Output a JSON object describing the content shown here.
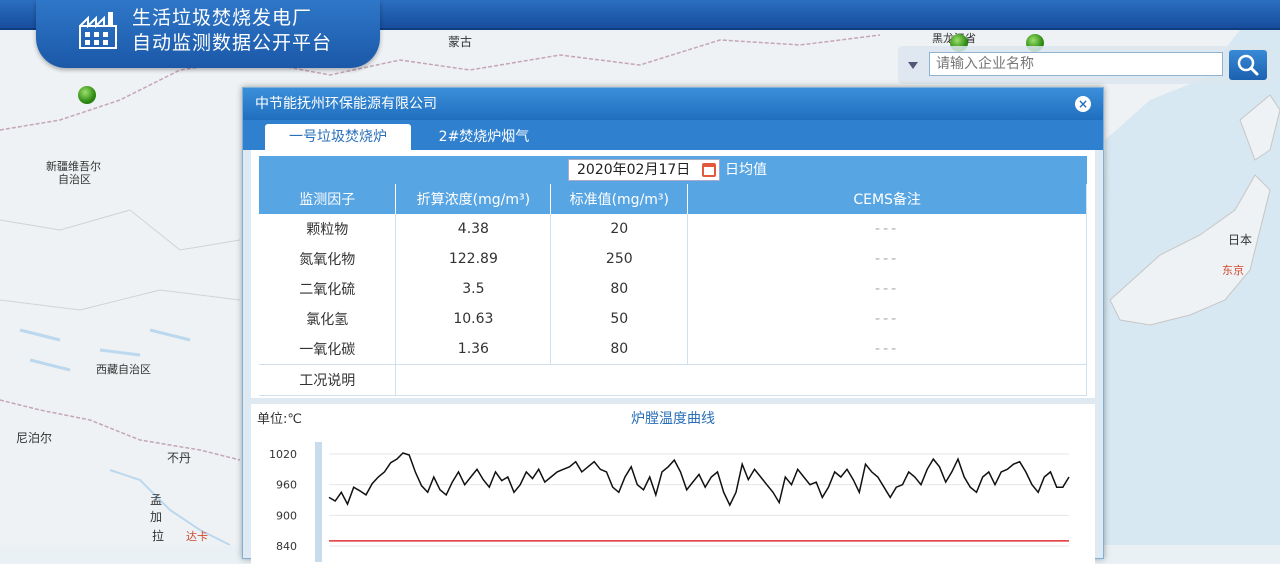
{
  "header": {
    "title_line1": "生活垃圾焚烧发电厂",
    "title_line2": "自动监测数据公开平台"
  },
  "search": {
    "placeholder": "请输入企业名称"
  },
  "map": {
    "labels": [
      {
        "key": "mongolia",
        "text": "蒙古"
      },
      {
        "key": "heilongjiang",
        "text": "黑龙江省"
      },
      {
        "key": "xinjiang1",
        "text": "新疆维吾尔"
      },
      {
        "key": "xinjiang2",
        "text": "自治区"
      },
      {
        "key": "tibet",
        "text": "西藏自治区"
      },
      {
        "key": "nepal",
        "text": "尼泊尔"
      },
      {
        "key": "bhutan",
        "text": "不丹"
      },
      {
        "key": "bangla1",
        "text": "孟"
      },
      {
        "key": "bangla2",
        "text": "加"
      },
      {
        "key": "bangla3",
        "text": "拉"
      },
      {
        "key": "dhaka",
        "text": "达卡"
      },
      {
        "key": "japan",
        "text": "日本"
      },
      {
        "key": "tokyo",
        "text": "东京"
      }
    ]
  },
  "popup": {
    "company": "中节能抚州环保能源有限公司",
    "close_symbol": "×",
    "tabs": [
      "一号垃圾焚烧炉",
      "2#焚烧炉烟气"
    ],
    "date": "2020年02月17日",
    "date_suffix": "日均值",
    "columns": [
      "监测因子",
      "折算浓度(mg/m³)",
      "标准值(mg/m³)",
      "CEMS备注"
    ],
    "rows": [
      {
        "factor": "颗粒物",
        "value": "4.38",
        "standard": "20",
        "note": "---"
      },
      {
        "factor": "氮氧化物",
        "value": "122.89",
        "standard": "250",
        "note": "---"
      },
      {
        "factor": "二氧化硫",
        "value": "3.5",
        "standard": "80",
        "note": "---"
      },
      {
        "factor": "氯化氢",
        "value": "10.63",
        "standard": "50",
        "note": "---"
      },
      {
        "factor": "一氧化碳",
        "value": "1.36",
        "standard": "80",
        "note": "---"
      }
    ],
    "condition_label": "工况说明",
    "condition_value": ""
  },
  "chart_data": {
    "type": "line",
    "title": "炉膛温度曲线",
    "unit": "单位:℃",
    "y_ticks": [
      "1020",
      "960",
      "900",
      "840"
    ],
    "ylim": [
      840,
      1020
    ],
    "reference_line": 850,
    "colors": {
      "series": "#111111",
      "reference": "#e03030"
    },
    "series": [
      {
        "values": [
          935,
          928,
          945,
          922,
          955,
          948,
          940,
          962,
          975,
          985,
          1003,
          1010,
          1022,
          1018,
          985,
          958,
          945,
          975,
          950,
          940,
          965,
          985,
          960,
          975,
          990,
          970,
          955,
          985,
          968,
          975,
          945,
          960,
          985,
          972,
          990,
          965,
          975,
          985,
          990,
          995,
          1005,
          985,
          995,
          1005,
          990,
          985,
          955,
          945,
          975,
          995,
          960,
          950,
          975,
          940,
          985,
          995,
          1008,
          985,
          950,
          965,
          980,
          955,
          975,
          985,
          945,
          920,
          945,
          1000,
          970,
          990,
          975,
          960,
          945,
          925,
          975,
          960,
          990,
          975,
          960,
          965,
          935,
          955,
          985,
          975,
          990,
          970,
          945,
          1000,
          985,
          975,
          955,
          935,
          955,
          960,
          985,
          975,
          960,
          990,
          1010,
          995,
          965,
          985,
          1010,
          975,
          955,
          945,
          975,
          985,
          960,
          985,
          990,
          1000,
          1005,
          985,
          960,
          945,
          975,
          985,
          955,
          955,
          975
        ]
      }
    ]
  }
}
